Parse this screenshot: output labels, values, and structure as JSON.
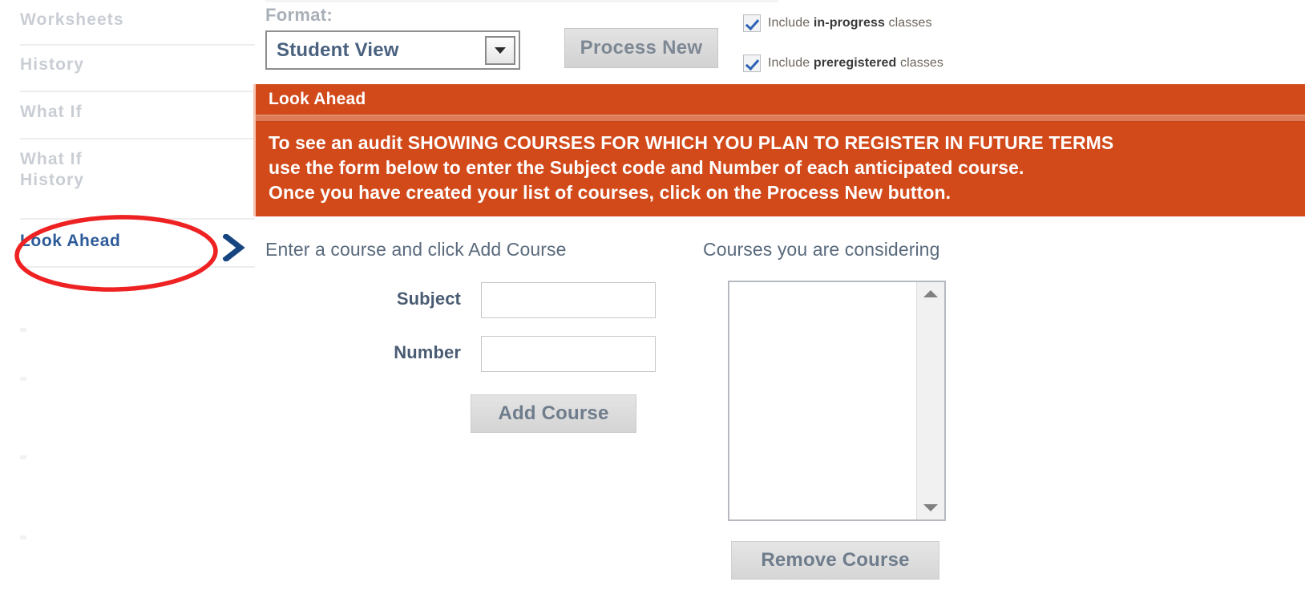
{
  "sidebar": {
    "items": [
      {
        "label": "Worksheets",
        "active": false
      },
      {
        "label": "History",
        "active": false
      },
      {
        "label": "What If",
        "active": false
      },
      {
        "label": "What If\nHistory",
        "active": false
      },
      {
        "label": "Look Ahead",
        "active": true
      }
    ],
    "chevron_icon": "chevron-right-icon",
    "annotation": {
      "shape": "ellipse",
      "color": "#ee2222",
      "target": "Look Ahead"
    }
  },
  "toolbar": {
    "format_label": "Format:",
    "format_value": "Student View",
    "format_options": [
      "Student View"
    ],
    "dropdown_icon": "chevron-down-icon",
    "process_new_label": "Process New",
    "checkboxes": [
      {
        "checked": true,
        "prefix": "Include ",
        "emphasis": "in-progress",
        "suffix": " classes"
      },
      {
        "checked": true,
        "prefix": "Include ",
        "emphasis": "preregistered",
        "suffix": " classes"
      }
    ]
  },
  "banner": {
    "title": "Look Ahead",
    "body": "To see an audit SHOWING COURSES FOR WHICH YOU PLAN TO REGISTER IN FUTURE TERMS\nuse the form below to enter the Subject code and Number of each anticipated course.\nOnce you have created your list of courses, click on the Process New button.",
    "background_color": "#d2491a",
    "text_color": "#ffffff"
  },
  "form": {
    "hint": "Enter a course and click Add Course",
    "subject_label": "Subject",
    "subject_value": "",
    "subject_placeholder": "",
    "number_label": "Number",
    "number_value": "",
    "number_placeholder": "",
    "add_course_label": "Add Course"
  },
  "considering": {
    "label": "Courses you are considering",
    "items": [],
    "scroll_up_icon": "triangle-up-icon",
    "scroll_down_icon": "triangle-down-icon",
    "remove_course_label": "Remove Course"
  }
}
